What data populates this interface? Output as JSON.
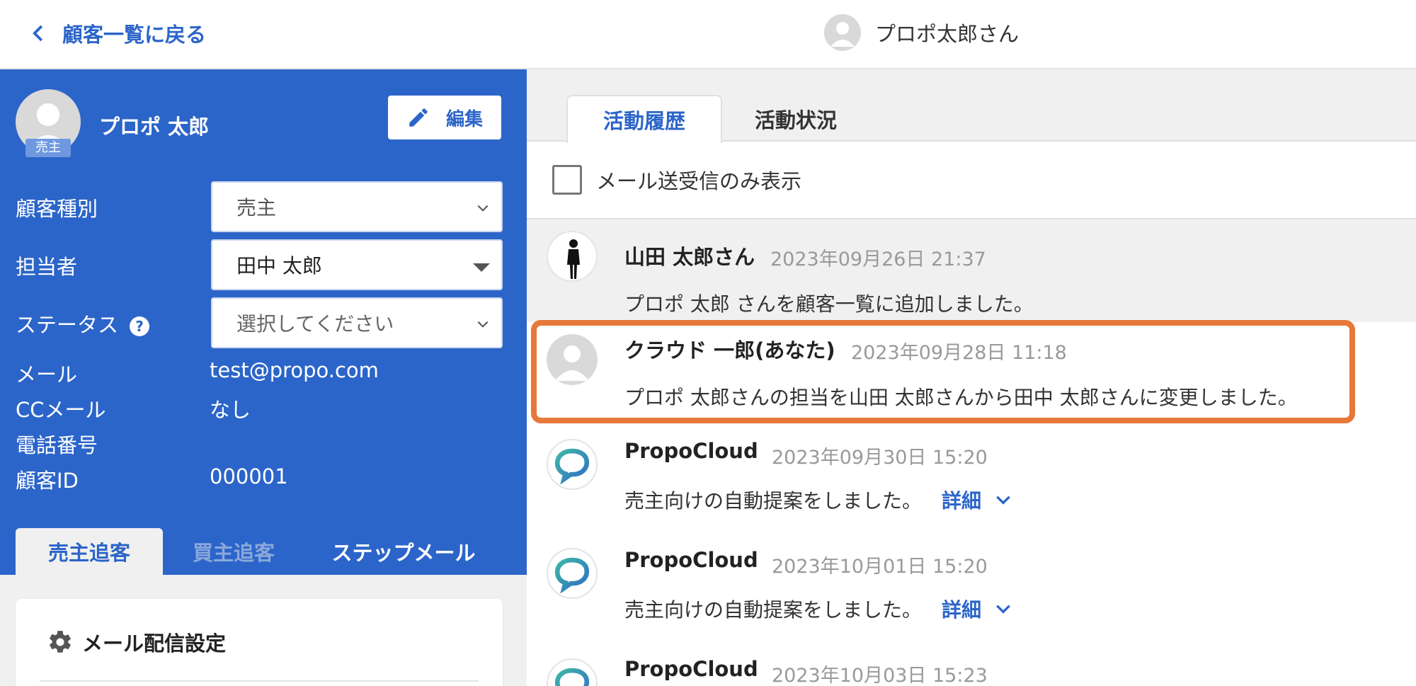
{
  "header": {
    "back_label": "顧客一覧に戻る",
    "user_name": "プロポ太郎さん"
  },
  "profile": {
    "name": "プロポ 太郎",
    "badge": "売主",
    "edit_label": "編集",
    "fields": {
      "type_label": "顧客種別",
      "type_value": "売主",
      "assignee_label": "担当者",
      "assignee_value": "田中 太郎",
      "status_label": "ステータス",
      "status_placeholder": "選択してください",
      "email_label": "メール",
      "email_value": "test@propo.com",
      "cc_label": "CCメール",
      "cc_value": "なし",
      "phone_label": "電話番号",
      "phone_value": "",
      "id_label": "顧客ID",
      "id_value": "000001"
    },
    "tabs": [
      "売主追客",
      "買主追客",
      "ステップメール"
    ],
    "card_title": "メール配信設定"
  },
  "activity": {
    "tabs": [
      "活動履歴",
      "活動状況"
    ],
    "filter_label": "メール送受信のみ表示",
    "items": [
      {
        "name": "山田 太郎さん",
        "time": "2023年09月26日 21:37",
        "message": "プロポ 太郎 さんを顧客一覧に追加しました。"
      },
      {
        "name": "クラウド 一郎(あなた)",
        "time": "2023年09月28日 11:18",
        "message": "プロポ 太郎さんの担当を山田 太郎さんから田中 太郎さんに変更しました。"
      },
      {
        "name": "PropoCloud",
        "time": "2023年09月30日 15:20",
        "message": "売主向けの自動提案をしました。",
        "detail": "詳細"
      },
      {
        "name": "PropoCloud",
        "time": "2023年10月01日 15:20",
        "message": "売主向けの自動提案をしました。",
        "detail": "詳細"
      },
      {
        "name": "PropoCloud",
        "time": "2023年10月03日 15:23"
      }
    ]
  },
  "colors": {
    "brand_blue": "#2c65c9",
    "highlight_orange": "#e6783a"
  }
}
